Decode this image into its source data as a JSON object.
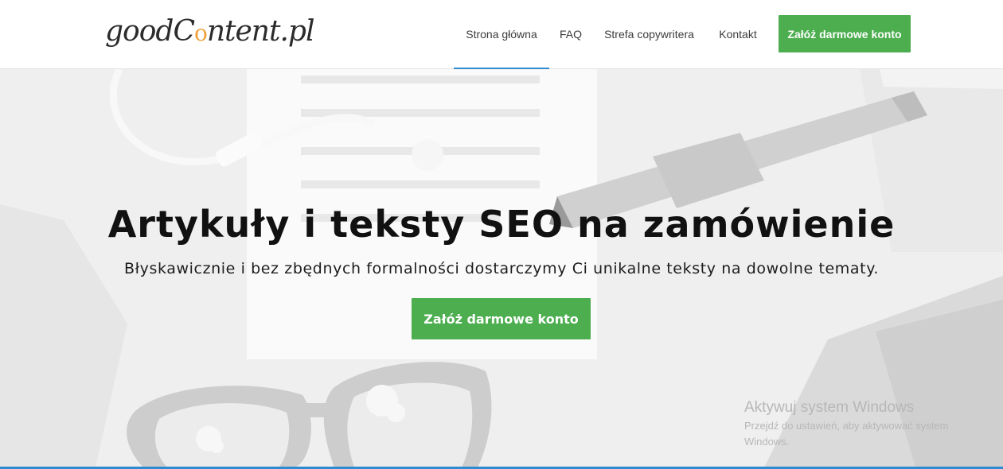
{
  "header": {
    "logo_text_pre": "goodC",
    "logo_bulb": "o",
    "logo_text_post": "ntent.pl",
    "nav": [
      {
        "label": "Strona główna",
        "active": true
      },
      {
        "label": "FAQ",
        "active": false
      },
      {
        "label": "Strefa copywritera",
        "active": false
      },
      {
        "label": "Kontakt",
        "active": false
      }
    ],
    "cta_label": "Załóż darmowe konto"
  },
  "hero": {
    "title": "Artykuły i teksty SEO na zamówienie",
    "subtitle": "Błyskawicznie i bez zbędnych formalności dostarczymy Ci unikalne teksty na dowolne tematy.",
    "cta_label": "Załóż darmowe konto"
  },
  "windows_watermark": {
    "title": "Aktywuj system Windows",
    "line1": "Przejdź do ustawień, aby aktywować system",
    "line2": "Windows."
  },
  "colors": {
    "accent_green": "#4cae4f",
    "active_blue": "#2e8bcf"
  }
}
